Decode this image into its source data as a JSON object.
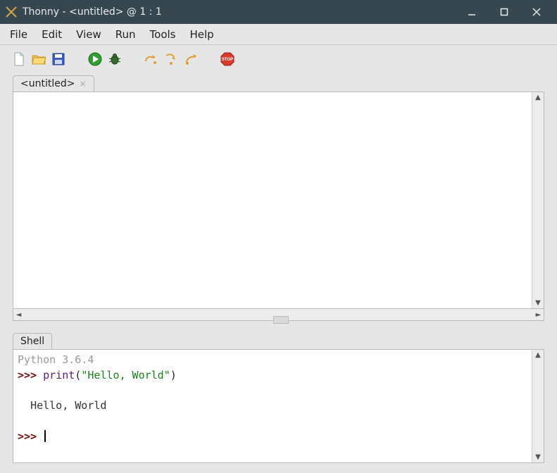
{
  "window": {
    "title": "Thonny  -  <untitled>  @  1 : 1"
  },
  "menu": {
    "items": [
      "File",
      "Edit",
      "View",
      "Run",
      "Tools",
      "Help"
    ]
  },
  "toolbar": {
    "new_tip": "New",
    "open_tip": "Open",
    "save_tip": "Save",
    "run_tip": "Run",
    "debug_tip": "Debug",
    "step_over_tip": "Step over",
    "step_into_tip": "Step into",
    "step_out_tip": "Step out",
    "stop_tip": "Stop"
  },
  "editor": {
    "tab_label": "<untitled>",
    "content": ""
  },
  "shell": {
    "tab_label": "Shell",
    "banner": "Python 3.6.4",
    "prompt": ">>> ",
    "history": [
      {
        "func": "print",
        "open_paren": "(",
        "string": "\"Hello, World\"",
        "close_paren": ")"
      }
    ],
    "output_indent": "  ",
    "output": "Hello, World"
  }
}
